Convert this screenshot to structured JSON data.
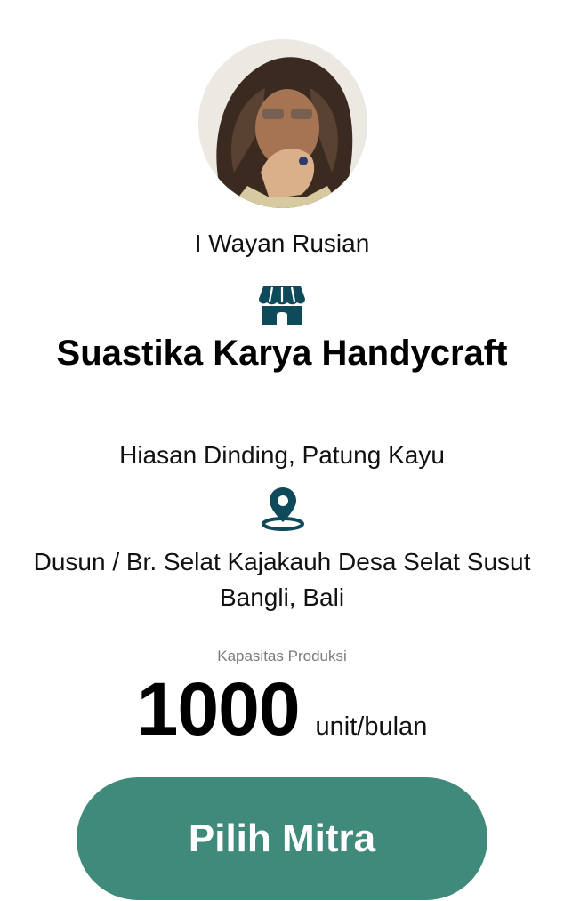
{
  "profile": {
    "owner_name": "I Wayan Rusian",
    "avatar_icon": "person-photo"
  },
  "store": {
    "icon": "storefront-icon",
    "name": "Suastika Karya Handycraft",
    "categories": "Hiasan Dinding, Patung Kayu"
  },
  "location": {
    "icon": "location-pin-icon",
    "address": "Dusun / Br. Selat Kajakauh Desa Selat Susut Bangli, Bali"
  },
  "capacity": {
    "label": "Kapasitas Produksi",
    "value": "1000",
    "unit": "unit/bulan"
  },
  "action": {
    "select_label": "Pilih Mitra"
  },
  "colors": {
    "accent": "#3f8a7a",
    "icon": "#0f4a5a"
  }
}
